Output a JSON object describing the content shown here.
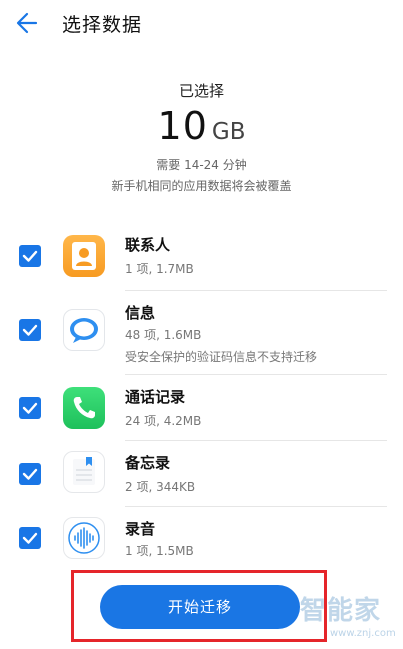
{
  "header": {
    "title": "选择数据"
  },
  "summary": {
    "selected_label": "已选择",
    "size_value": "10",
    "size_unit": "GB",
    "time_note": "需要 14-24 分钟",
    "overwrite_note": "新手机相同的应用数据将会被覆盖"
  },
  "items": [
    {
      "title": "联系人",
      "subtitle": "1 项, 1.7MB",
      "note": "",
      "checked": true,
      "icon": "contacts-icon"
    },
    {
      "title": "信息",
      "subtitle": "48 项, 1.6MB",
      "note": "受安全保护的验证码信息不支持迁移",
      "checked": true,
      "icon": "messages-icon"
    },
    {
      "title": "通话记录",
      "subtitle": "24 项, 4.2MB",
      "note": "",
      "checked": true,
      "icon": "phone-icon"
    },
    {
      "title": "备忘录",
      "subtitle": "2 项, 344KB",
      "note": "",
      "checked": true,
      "icon": "notes-icon"
    },
    {
      "title": "录音",
      "subtitle": "1 项, 1.5MB",
      "note": "",
      "checked": true,
      "icon": "recorder-icon"
    }
  ],
  "action": {
    "start_label": "开始迁移"
  },
  "watermark": {
    "text": "智能家",
    "url": "www.znj.com"
  },
  "colors": {
    "accent": "#1a76e4",
    "highlight_frame": "#e5252a"
  }
}
